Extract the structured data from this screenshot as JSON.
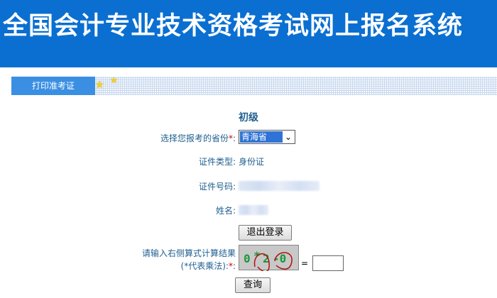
{
  "header": {
    "title": "全国会计专业技术资格考试网上报名系统"
  },
  "tabs": {
    "active_label": "打印准考证"
  },
  "form": {
    "level": "初级",
    "province_label": "选择您报考的省份",
    "required_mark": "*",
    "colon": ":",
    "province_value": "青海省",
    "id_type_label": "证件类型:",
    "id_type_value": "身份证",
    "id_number_label": "证件号码:",
    "name_label": "姓名:",
    "logout_button": "退出登录",
    "captcha_label_line1": "请输入右侧算式计算结果",
    "captcha_label_line2": "(*代表乘法):",
    "captcha_text": {
      "a": "0",
      "op": "*",
      "b": "2",
      "c": "-0"
    },
    "equals": "=",
    "query_button": "查询"
  },
  "colors": {
    "header_bg": "#0a6fd1",
    "tab_bg": "#3b8fe2",
    "label_text": "#1f5f8f",
    "required": "#d10000"
  }
}
